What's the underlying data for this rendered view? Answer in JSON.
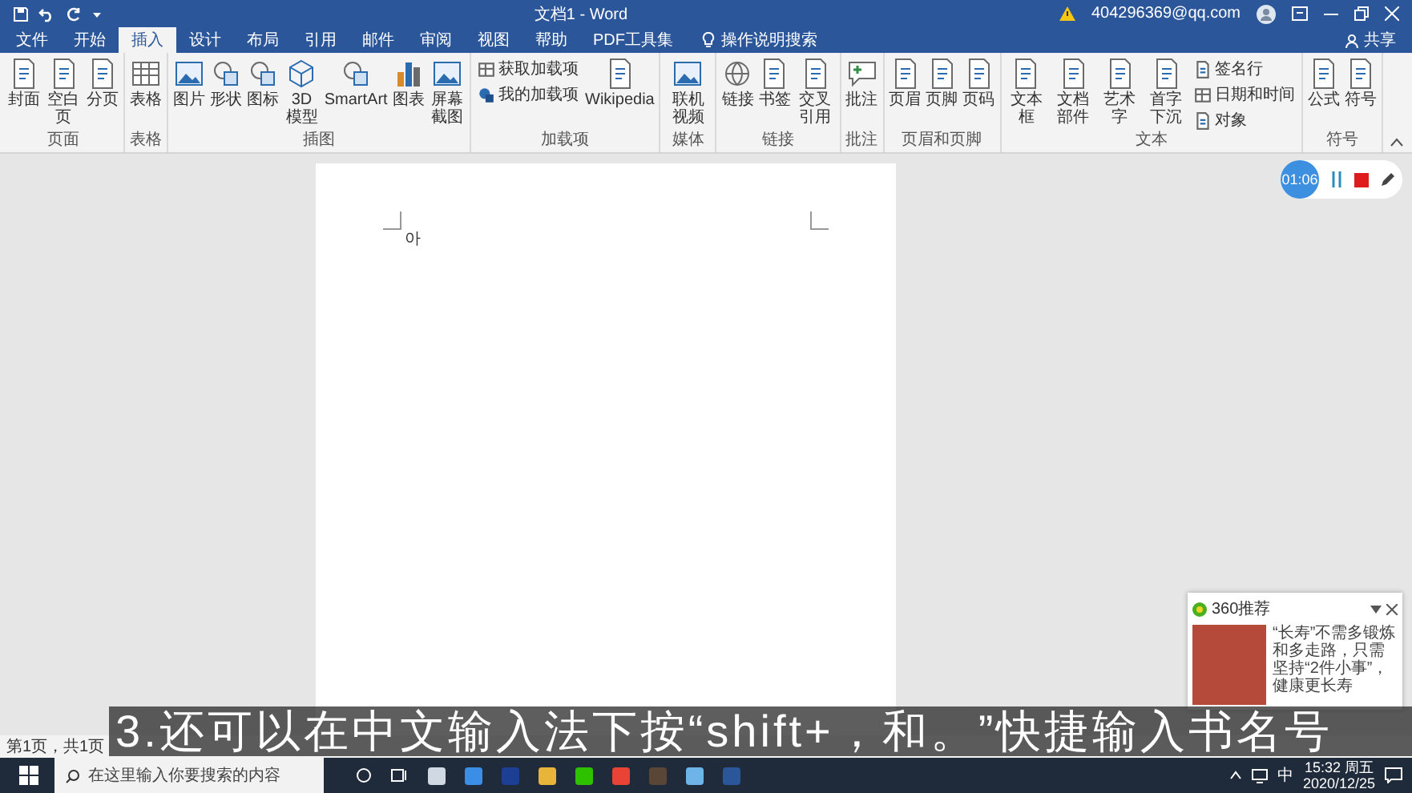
{
  "title_bar": {
    "title": "文档1 - Word",
    "account": "404296369@qq.com"
  },
  "tabs": [
    {
      "label": "文件",
      "selected": false
    },
    {
      "label": "开始",
      "selected": false
    },
    {
      "label": "插入",
      "selected": true
    },
    {
      "label": "设计",
      "selected": false
    },
    {
      "label": "布局",
      "selected": false
    },
    {
      "label": "引用",
      "selected": false
    },
    {
      "label": "邮件",
      "selected": false
    },
    {
      "label": "审阅",
      "selected": false
    },
    {
      "label": "视图",
      "selected": false
    },
    {
      "label": "帮助",
      "selected": false
    },
    {
      "label": "PDF工具集",
      "selected": false
    }
  ],
  "tell_me": "操作说明搜索",
  "share": "共享",
  "ribbon_groups": [
    {
      "label": "页面",
      "items": [
        {
          "kind": "large",
          "label": "封面"
        },
        {
          "kind": "large",
          "label": "空白页"
        },
        {
          "kind": "large",
          "label": "分页"
        }
      ]
    },
    {
      "label": "表格",
      "items": [
        {
          "kind": "large",
          "label": "表格"
        }
      ]
    },
    {
      "label": "插图",
      "items": [
        {
          "kind": "large",
          "label": "图片"
        },
        {
          "kind": "large",
          "label": "形状"
        },
        {
          "kind": "large",
          "label": "图标"
        },
        {
          "kind": "large",
          "label": "3D模型"
        },
        {
          "kind": "large",
          "label": "SmartArt"
        },
        {
          "kind": "large",
          "label": "图表"
        },
        {
          "kind": "large",
          "label": "屏幕截图"
        }
      ]
    },
    {
      "label": "加载项",
      "items": [
        {
          "kind": "small",
          "label": "获取加载项"
        },
        {
          "kind": "small",
          "label": "我的加载项"
        },
        {
          "kind": "large",
          "label": "Wikipedia"
        }
      ]
    },
    {
      "label": "媒体",
      "items": [
        {
          "kind": "large",
          "label": "联机视频"
        }
      ]
    },
    {
      "label": "链接",
      "items": [
        {
          "kind": "large",
          "label": "链接"
        },
        {
          "kind": "large",
          "label": "书签"
        },
        {
          "kind": "large",
          "label": "交叉引用"
        }
      ]
    },
    {
      "label": "批注",
      "items": [
        {
          "kind": "large",
          "label": "批注"
        }
      ]
    },
    {
      "label": "页眉和页脚",
      "items": [
        {
          "kind": "large",
          "label": "页眉"
        },
        {
          "kind": "large",
          "label": "页脚"
        },
        {
          "kind": "large",
          "label": "页码"
        }
      ]
    },
    {
      "label": "文本",
      "items": [
        {
          "kind": "large",
          "label": "文本框"
        },
        {
          "kind": "large",
          "label": "文档部件"
        },
        {
          "kind": "large",
          "label": "艺术字"
        },
        {
          "kind": "large",
          "label": "首字下沉"
        },
        {
          "kind": "small",
          "label": "签名行"
        },
        {
          "kind": "small",
          "label": "日期和时间"
        },
        {
          "kind": "small",
          "label": "对象"
        }
      ]
    },
    {
      "label": "符号",
      "items": [
        {
          "kind": "large",
          "label": "公式"
        },
        {
          "kind": "large",
          "label": "符号"
        }
      ]
    }
  ],
  "recorder": {
    "time": "01:06"
  },
  "document": {
    "text": "아"
  },
  "status_bar": {
    "page": "第1页，共1页"
  },
  "popup": {
    "title": "360推荐",
    "text": "“长寿”不需多锻炼和多走路，只需坚持“2件小事”，健康更长寿"
  },
  "taskbar": {
    "search_placeholder": "在这里输入你要搜索的内容",
    "ime": "中",
    "time": "15:32 周五",
    "date": "2020/12/25"
  },
  "caption": "3.还可以在中文输入法下按“shift+，和。”快捷输入书名号"
}
